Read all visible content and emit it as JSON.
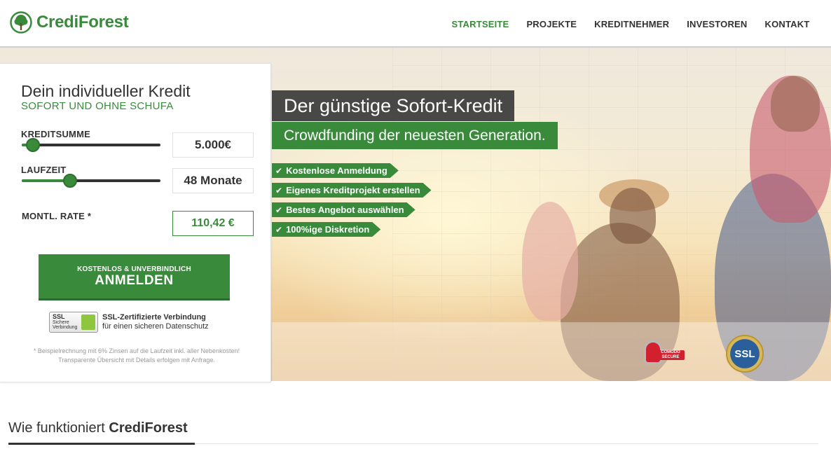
{
  "header": {
    "logo_text": "CrediForest",
    "nav": [
      {
        "label": "STARTSEITE",
        "active": true
      },
      {
        "label": "PROJEKTE",
        "active": false
      },
      {
        "label": "KREDITNEHMER",
        "active": false
      },
      {
        "label": "INVESTOREN",
        "active": false
      },
      {
        "label": "KONTAKT",
        "active": false
      }
    ]
  },
  "calculator": {
    "title": "Dein individueller Kredit",
    "subtitle": "SOFORT UND OHNE SCHUFA",
    "amount_label": "KREDITSUMME",
    "amount_value": "5.000€",
    "amount_fraction": 0.08,
    "term_label": "LAUFZEIT",
    "term_value": "48 Monate",
    "term_fraction": 0.35,
    "rate_label": "MONTL. RATE *",
    "rate_value": "110,42 €",
    "cta_small": "KOSTENLOS & UNVERBINDLICH",
    "cta_big": "ANMELDEN",
    "ssl_badge_title": "SSL",
    "ssl_badge_line1": "Sichere",
    "ssl_badge_line2": "Verbindung",
    "ssl_title": "SSL-Zertifizierte Verbindung",
    "ssl_sub": "für einen sicheren Datenschutz",
    "footnote": "* Beispielrechnung mit 6% Zinsen auf die Laufzeit inkl. aller Nebenkosten! Transparente Übersicht mit Details erfolgen mit Anfrage."
  },
  "hero": {
    "headline": "Der günstige Sofort-Kredit",
    "subheadline": "Crowdfunding der neuesten Generation.",
    "features": [
      "Kostenlose Anmeldung",
      "Eigenes Kreditprojekt erstellen",
      "Bestes Angebot auswählen",
      "100%ige Diskretion"
    ],
    "check_glyph": "✔",
    "comodo_line1": "COMODO",
    "comodo_line2": "SECURE",
    "ssl_seal": "SSL"
  },
  "section": {
    "title_prefix": "Wie funktioniert",
    "title_brand": "CrediForest"
  },
  "colors": {
    "brand_green": "#3a8a3c",
    "dark_banner": "#3a3a3a"
  }
}
